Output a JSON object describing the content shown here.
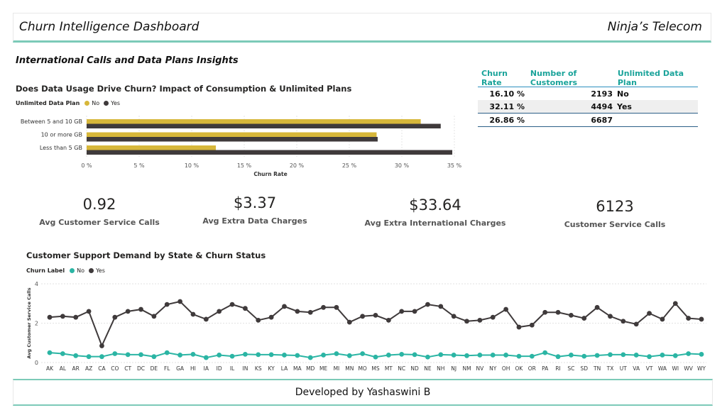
{
  "header": {
    "title": "Churn Intelligence Dashboard",
    "company": "Ninja’s Telecom"
  },
  "section_title": "International Calls and Data Plans Insights",
  "table": {
    "headers": [
      "Churn Rate",
      "Number of Customers",
      "Unlimited Data Plan"
    ],
    "rows": [
      {
        "churn_rate": "16.10 %",
        "customers": "2193",
        "plan": "No"
      },
      {
        "churn_rate": "32.11 %",
        "customers": "4494",
        "plan": "Yes"
      }
    ],
    "total": {
      "churn_rate": "26.86 %",
      "customers": "6687",
      "plan": ""
    }
  },
  "kpis": [
    {
      "value": "0.92",
      "label": "Avg Customer Service Calls"
    },
    {
      "value": "$3.37",
      "label": "Avg Extra Data Charges"
    },
    {
      "value": "$33.64",
      "label": "Avg Extra International Charges"
    },
    {
      "value": "6123",
      "label": "Customer Service Calls"
    }
  ],
  "footer": {
    "text": "Developed by Yashaswini B"
  },
  "chart_data": [
    {
      "type": "bar",
      "orientation": "horizontal",
      "title": "Does Data Usage Drive Churn? Impact of Consumption & Unlimited Plans",
      "legend_title": "Unlimited Data Plan",
      "categories": [
        "Between 5 and 10 GB",
        "10 or more GB",
        "Less than 5 GB"
      ],
      "series": [
        {
          "name": "No",
          "color": "#d7b73a",
          "values": [
            31.8,
            27.6,
            12.3
          ]
        },
        {
          "name": "Yes",
          "color": "#3f3a3b",
          "values": [
            33.7,
            27.7,
            34.8
          ]
        }
      ],
      "xlabel": "Churn Rate",
      "xlim": [
        0,
        35
      ],
      "xticks": [
        "0 %",
        "5 %",
        "10 %",
        "15 %",
        "20 %",
        "25 %",
        "30 %",
        "35 %"
      ],
      "legend_position": "top-left"
    },
    {
      "type": "line",
      "title": "Customer Support Demand by State & Churn Status",
      "legend_title": "Churn Label",
      "x": [
        "AK",
        "AL",
        "AR",
        "AZ",
        "CA",
        "CO",
        "CT",
        "DC",
        "DE",
        "FL",
        "GA",
        "HI",
        "IA",
        "ID",
        "IL",
        "IN",
        "KS",
        "KY",
        "LA",
        "MA",
        "MD",
        "ME",
        "MI",
        "MN",
        "MO",
        "MS",
        "MT",
        "NC",
        "ND",
        "NE",
        "NH",
        "NJ",
        "NM",
        "NV",
        "NY",
        "OH",
        "OK",
        "OR",
        "PA",
        "RI",
        "SC",
        "SD",
        "TN",
        "TX",
        "UT",
        "VA",
        "VT",
        "WA",
        "WI",
        "WV",
        "WY"
      ],
      "series": [
        {
          "name": "No",
          "color": "#2bb5a4",
          "values": [
            0.5,
            0.45,
            0.35,
            0.3,
            0.3,
            0.45,
            0.4,
            0.4,
            0.3,
            0.5,
            0.38,
            0.42,
            0.25,
            0.38,
            0.32,
            0.42,
            0.4,
            0.4,
            0.38,
            0.36,
            0.25,
            0.38,
            0.45,
            0.35,
            0.45,
            0.28,
            0.38,
            0.42,
            0.4,
            0.28,
            0.4,
            0.38,
            0.35,
            0.38,
            0.38,
            0.38,
            0.32,
            0.32,
            0.5,
            0.3,
            0.38,
            0.32,
            0.36,
            0.4,
            0.4,
            0.38,
            0.3,
            0.38,
            0.35,
            0.45,
            0.42
          ]
        },
        {
          "name": "Yes",
          "color": "#3f3a3b",
          "values": [
            2.3,
            2.35,
            2.3,
            2.6,
            0.85,
            2.3,
            2.6,
            2.7,
            2.35,
            2.95,
            3.1,
            2.45,
            2.2,
            2.6,
            2.95,
            2.75,
            2.15,
            2.3,
            2.85,
            2.6,
            2.55,
            2.8,
            2.8,
            2.05,
            2.35,
            2.4,
            2.15,
            2.6,
            2.6,
            2.95,
            2.85,
            2.35,
            2.1,
            2.15,
            2.3,
            2.7,
            1.8,
            1.9,
            2.55,
            2.55,
            2.4,
            2.25,
            2.8,
            2.35,
            2.1,
            1.95,
            2.5,
            2.2,
            3.0,
            2.25,
            2.2
          ]
        }
      ],
      "ylabel": "Avg Customer Service Calls",
      "ylim": [
        0,
        4
      ],
      "yticks": [
        "0",
        "2",
        "4"
      ],
      "grid": true,
      "legend_position": "top-left"
    }
  ]
}
